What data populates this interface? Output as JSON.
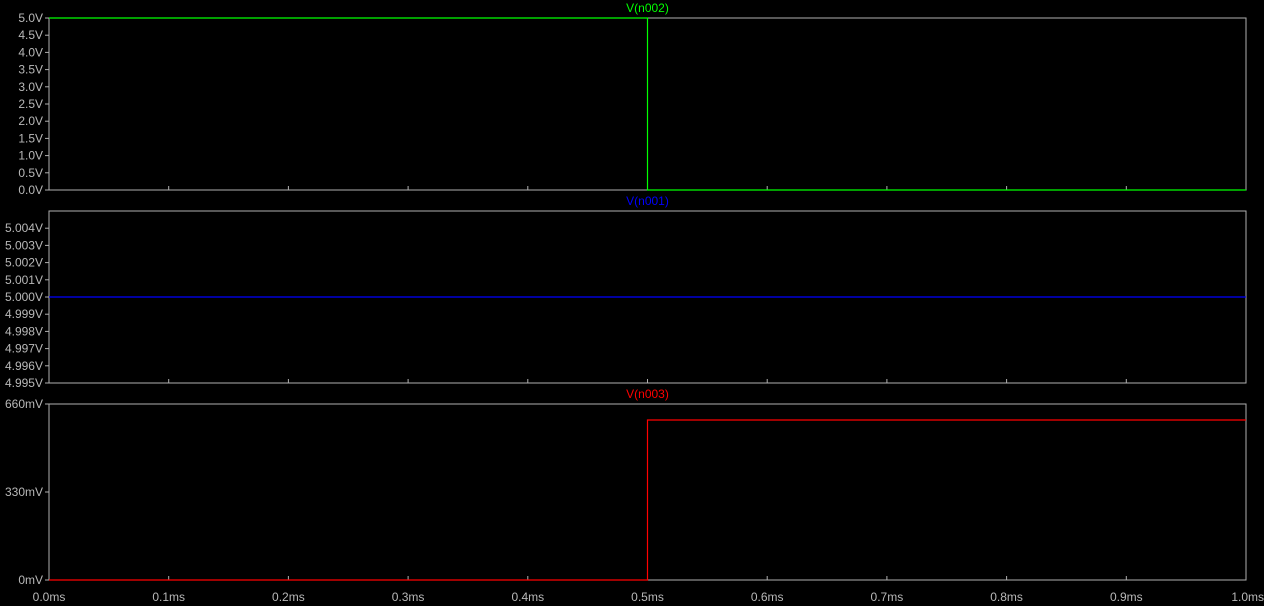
{
  "background_color": "#000000",
  "frame_color": "#b0b0b0",
  "x_axis": {
    "unit": "ms",
    "range": [
      0.0,
      1.0
    ],
    "tick_labels": [
      "0.0ms",
      "0.1ms",
      "0.2ms",
      "0.3ms",
      "0.4ms",
      "0.5ms",
      "0.6ms",
      "0.7ms",
      "0.8ms",
      "0.9ms",
      "1.0ms"
    ]
  },
  "chart_data": [
    {
      "type": "line",
      "title": "V(n002)",
      "color": "#00ff00",
      "ylim": [
        0.0,
        5.0
      ],
      "y_ticks": [
        0.0,
        0.5,
        1.0,
        1.5,
        2.0,
        2.5,
        3.0,
        3.5,
        4.0,
        4.5,
        5.0
      ],
      "y_tick_labels": [
        "0.0V",
        "0.5V",
        "1.0V",
        "1.5V",
        "2.0V",
        "2.5V",
        "3.0V",
        "3.5V",
        "4.0V",
        "4.5V",
        "5.0V"
      ],
      "series": [
        {
          "x": [
            0.0,
            0.5,
            0.5,
            1.0
          ],
          "y": [
            5.0,
            5.0,
            0.0,
            0.0
          ]
        }
      ]
    },
    {
      "type": "line",
      "title": "V(n001)",
      "color": "#0000ff",
      "ylim": [
        4.995,
        5.005
      ],
      "y_ticks": [
        4.995,
        4.996,
        4.997,
        4.998,
        4.999,
        5.0,
        5.001,
        5.002,
        5.003,
        5.004
      ],
      "y_tick_labels": [
        "4.995V",
        "4.996V",
        "4.997V",
        "4.998V",
        "4.999V",
        "5.000V",
        "5.001V",
        "5.002V",
        "5.003V",
        "5.004V"
      ],
      "series": [
        {
          "x": [
            0.0,
            1.0
          ],
          "y": [
            5.0,
            5.0
          ]
        }
      ]
    },
    {
      "type": "line",
      "title": "V(n003)",
      "color": "#ff0000",
      "ylim": [
        0,
        660
      ],
      "y_ticks": [
        0,
        330,
        660
      ],
      "y_tick_labels": [
        "0mV",
        "330mV",
        "660mV"
      ],
      "series": [
        {
          "x": [
            0.0,
            0.5,
            0.5,
            1.0
          ],
          "y": [
            0,
            0,
            600,
            600
          ]
        }
      ]
    }
  ]
}
